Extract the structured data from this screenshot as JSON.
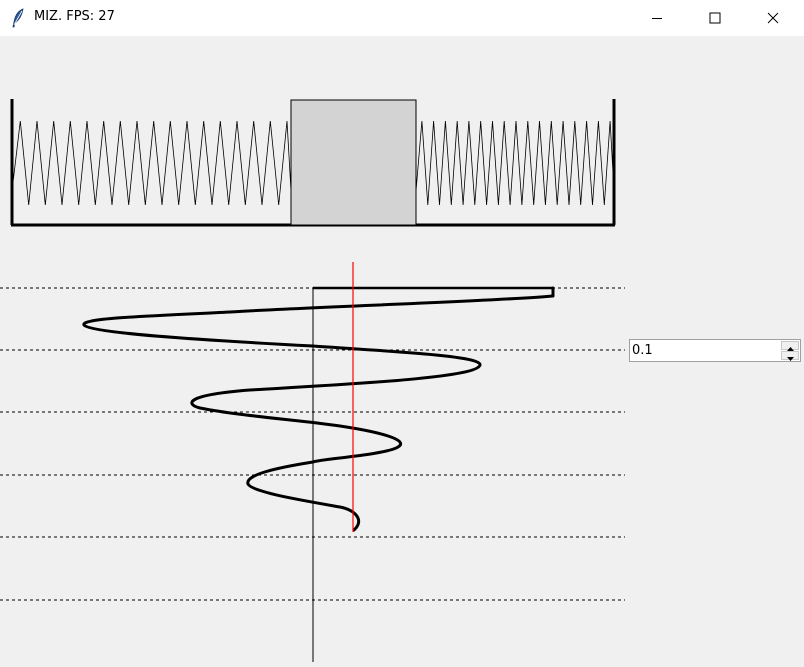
{
  "window": {
    "title": "MIZ. FPS: 27",
    "controls": [
      "minimize-icon",
      "maximize-icon",
      "close-icon"
    ]
  },
  "spinbox": {
    "value": "0.1"
  },
  "colors": {
    "background": "#f0f0f0",
    "mass_fill": "#d3d3d3",
    "trace": "#000000",
    "marker": "#ff0000",
    "guides": "#000000"
  }
}
